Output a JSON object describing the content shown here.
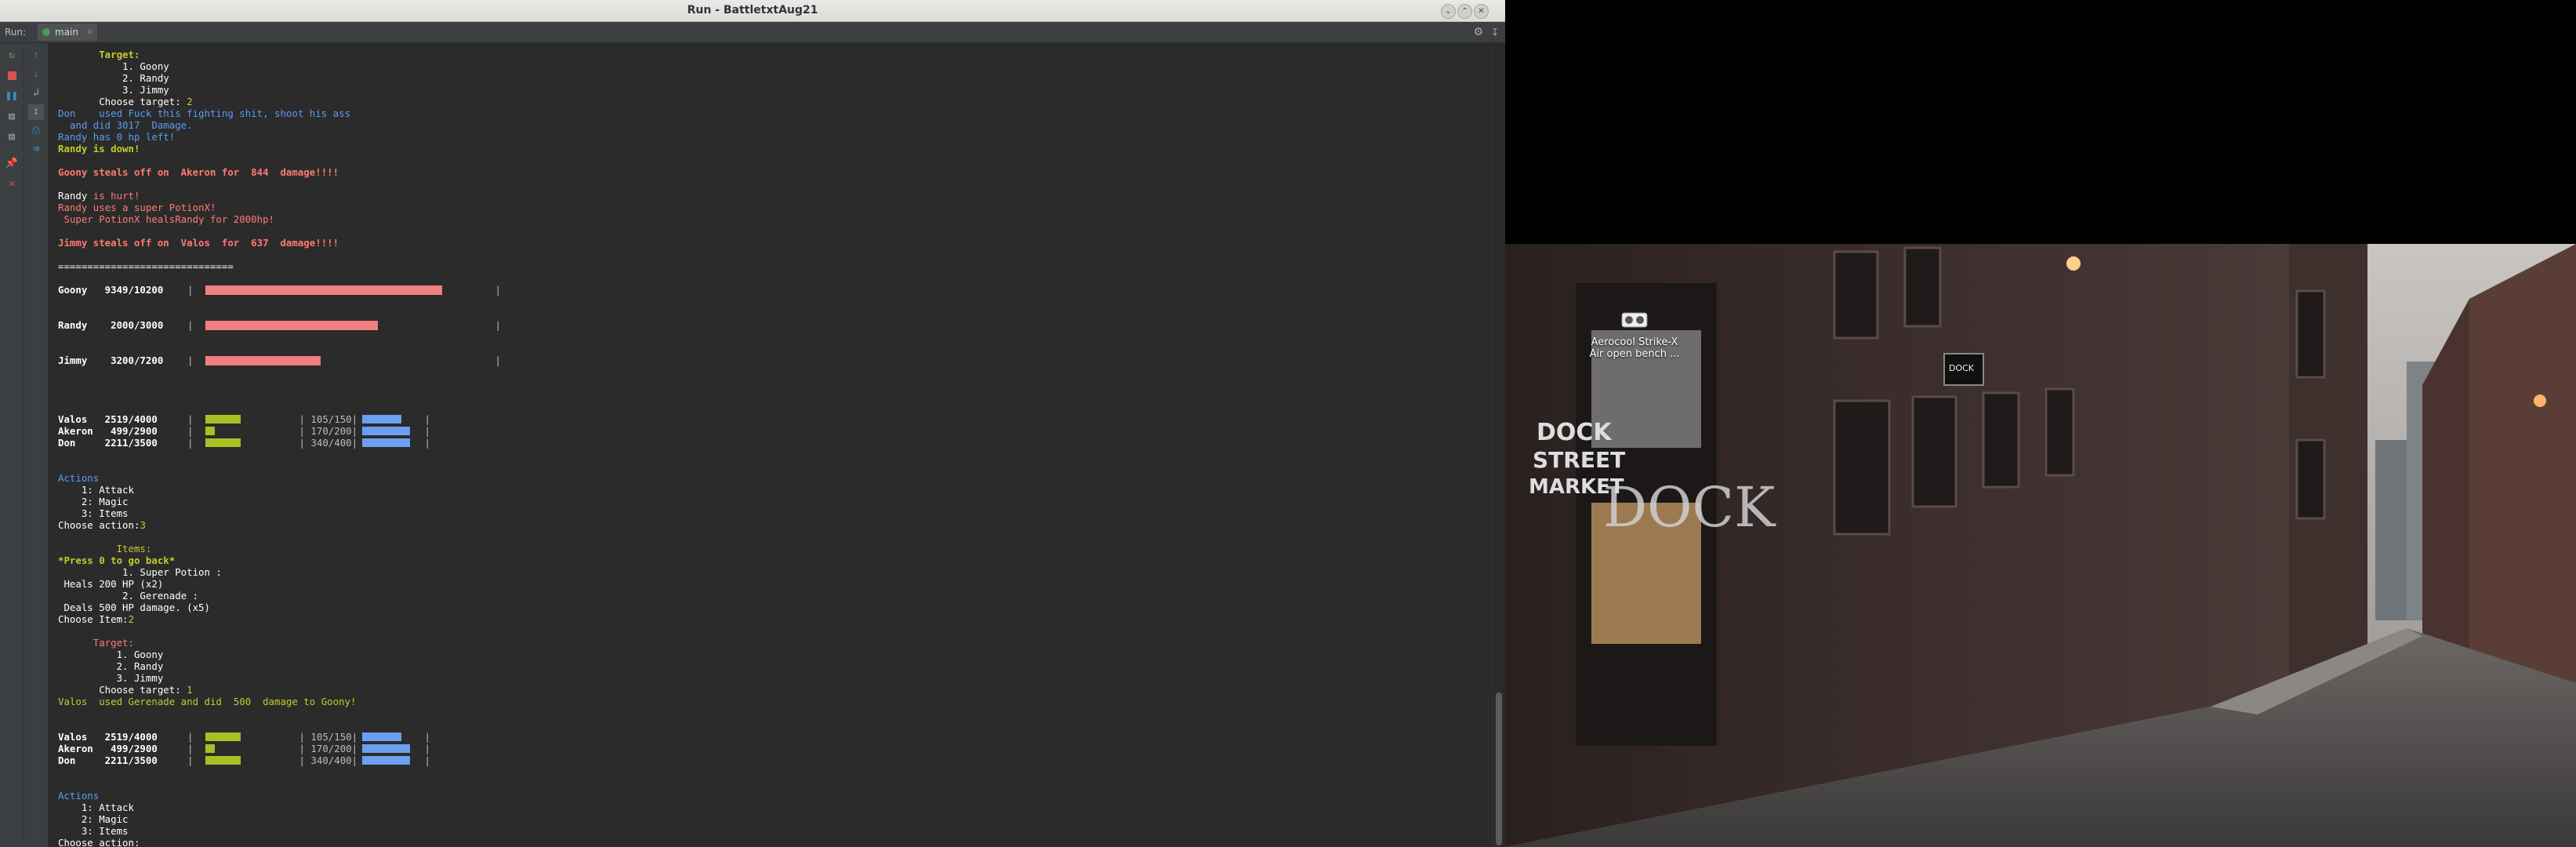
{
  "window": {
    "title": "Run - BattletxtAug21",
    "controls": [
      "minimize",
      "maximize",
      "close"
    ]
  },
  "run_panel": {
    "label": "Run:",
    "tab_label": "main",
    "tab_close": "×"
  },
  "toolbar_icons": [
    "rerun-icon",
    "stop-icon",
    "pause-icon",
    "dump-threads-icon",
    "settings-icon",
    "pin-icon",
    "close-icon",
    "up-icon",
    "down-icon",
    "soft-wrap-icon",
    "scroll-to-end-icon",
    "print-icon",
    "clear-icon"
  ],
  "colors": {
    "bg": "#2b2b2b",
    "text": "#bbbbbb",
    "yellow": "#c4ca2c",
    "red": "#ff7b72",
    "blue": "#589df6",
    "hp_bar": "#f08080",
    "green_bar": "#a8c023",
    "blue_bar": "#6c9ff2"
  },
  "console_lines": [
    {
      "c": "yb",
      "t": "       Target:"
    },
    {
      "c": "w",
      "t": "           1. Goony"
    },
    {
      "c": "w",
      "t": "           2. Randy"
    },
    {
      "c": "w",
      "t": "           3. Jimmy"
    },
    {
      "c": "w",
      "t": "       Choose target: ",
      "tail": "2",
      "tailc": "g"
    },
    {
      "c": "b",
      "t": "Don    used Fuck this fighting shit, shoot his ass"
    },
    {
      "c": "b",
      "t": "  and did 3017  Damage."
    },
    {
      "c": "b",
      "t": "Randy has 0 hp left!"
    },
    {
      "c": "yb",
      "t": "Randy is down!"
    },
    {
      "c": "w",
      "t": ""
    },
    {
      "c": "rb",
      "t": "Goony steals off on  Akeron for  844  damage!!!!"
    },
    {
      "c": "w",
      "t": ""
    },
    {
      "c": "w",
      "t": "Randy ",
      "tail": "is hurt!",
      "tailc": "r"
    },
    {
      "c": "r",
      "t": "Randy uses a super PotionX!"
    },
    {
      "c": "r",
      "t": " Super PotionX healsRandy for 2000hp!"
    },
    {
      "c": "w",
      "t": ""
    },
    {
      "c": "rb",
      "t": "Jimmy steals off on  Valos  for  637  damage!!!!"
    },
    {
      "c": "w",
      "t": ""
    },
    {
      "c": "w",
      "t": "=============================="
    },
    {
      "c": "w",
      "t": ""
    },
    {
      "c": "bw",
      "t": "Goony   9349/10200"
    },
    {
      "c": "w",
      "t": ""
    },
    {
      "c": "w",
      "t": ""
    },
    {
      "c": "bw",
      "t": "Randy    2000/3000"
    },
    {
      "c": "w",
      "t": ""
    },
    {
      "c": "w",
      "t": ""
    },
    {
      "c": "bw",
      "t": "Jimmy    3200/7200"
    },
    {
      "c": "w",
      "t": ""
    },
    {
      "c": "w",
      "t": ""
    },
    {
      "c": "w",
      "t": ""
    },
    {
      "c": "w",
      "t": ""
    },
    {
      "c": "bw",
      "t": "Valos   2519/4000"
    },
    {
      "c": "bw",
      "t": "Akeron   499/2900"
    },
    {
      "c": "bw",
      "t": "Don     2211/3500"
    },
    {
      "c": "w",
      "t": ""
    },
    {
      "c": "w",
      "t": ""
    },
    {
      "c": "b",
      "t": "Actions"
    },
    {
      "c": "w",
      "t": "    1: Attack"
    },
    {
      "c": "w",
      "t": "    2: Magic"
    },
    {
      "c": "w",
      "t": "    3: Items"
    },
    {
      "c": "w",
      "t": "Choose action:",
      "tail": "3",
      "tailc": "g"
    },
    {
      "c": "w",
      "t": ""
    },
    {
      "c": "g",
      "t": "          Items:"
    },
    {
      "c": "yb",
      "t": "*Press 0 to go back*"
    },
    {
      "c": "w",
      "t": "           1. Super Potion :"
    },
    {
      "c": "w",
      "t": " Heals 200 HP (x2)"
    },
    {
      "c": "w",
      "t": "           2. Gerenade :"
    },
    {
      "c": "w",
      "t": " Deals 500 HP damage. (x5)"
    },
    {
      "c": "w",
      "t": "Choose Item:",
      "tail": "2",
      "tailc": "g"
    },
    {
      "c": "w",
      "t": ""
    },
    {
      "c": "r",
      "t": "      Target:"
    },
    {
      "c": "w",
      "t": "          1. Goony"
    },
    {
      "c": "w",
      "t": "          2. Randy"
    },
    {
      "c": "w",
      "t": "          3. Jimmy"
    },
    {
      "c": "w",
      "t": "       Choose target: ",
      "tail": "1",
      "tailc": "g"
    },
    {
      "c": "g",
      "t": "Valos  used Gerenade and did  500  damage to Goony!"
    },
    {
      "c": "w",
      "t": ""
    },
    {
      "c": "w",
      "t": ""
    },
    {
      "c": "bw",
      "t": "Valos   2519/4000"
    },
    {
      "c": "bw",
      "t": "Akeron   499/2900"
    },
    {
      "c": "bw",
      "t": "Don     2211/3500"
    },
    {
      "c": "w",
      "t": ""
    },
    {
      "c": "w",
      "t": ""
    },
    {
      "c": "b",
      "t": "Actions"
    },
    {
      "c": "w",
      "t": "    1: Attack"
    },
    {
      "c": "w",
      "t": "    2: Magic"
    },
    {
      "c": "w",
      "t": "    3: Items"
    },
    {
      "c": "w",
      "t": "Choose action:"
    }
  ],
  "enemy_bars": [
    {
      "name": "Goony",
      "hp": 9349,
      "max": 10200
    },
    {
      "name": "Randy",
      "hp": 2000,
      "max": 3000
    },
    {
      "name": "Jimmy",
      "hp": 3200,
      "max": 7200
    }
  ],
  "party_blocks": [
    [
      {
        "name": "Valos",
        "hp": 2519,
        "max": 4000,
        "mp_text": "105/150",
        "mp": 105,
        "mp_max": 150
      },
      {
        "name": "Akeron",
        "hp": 499,
        "max": 2900,
        "mp_text": "170/200",
        "mp": 170,
        "mp_max": 200
      },
      {
        "name": "Don",
        "hp": 2211,
        "max": 3500,
        "mp_text": "340/400",
        "mp": 340,
        "mp_max": 400
      }
    ],
    [
      {
        "name": "Valos",
        "hp": 2519,
        "max": 4000,
        "mp_text": "105/150",
        "mp": 105,
        "mp_max": 150
      },
      {
        "name": "Akeron",
        "hp": 499,
        "max": 2900,
        "mp_text": "170/200",
        "mp": 170,
        "mp_max": 200
      },
      {
        "name": "Don",
        "hp": 2211,
        "max": 3500,
        "mp_text": "340/400",
        "mp": 340,
        "mp_max": 400
      }
    ]
  ],
  "desktop": {
    "icon_label_1": "Aerocool Strike-X",
    "icon_label_2": "Air open bench ..."
  }
}
